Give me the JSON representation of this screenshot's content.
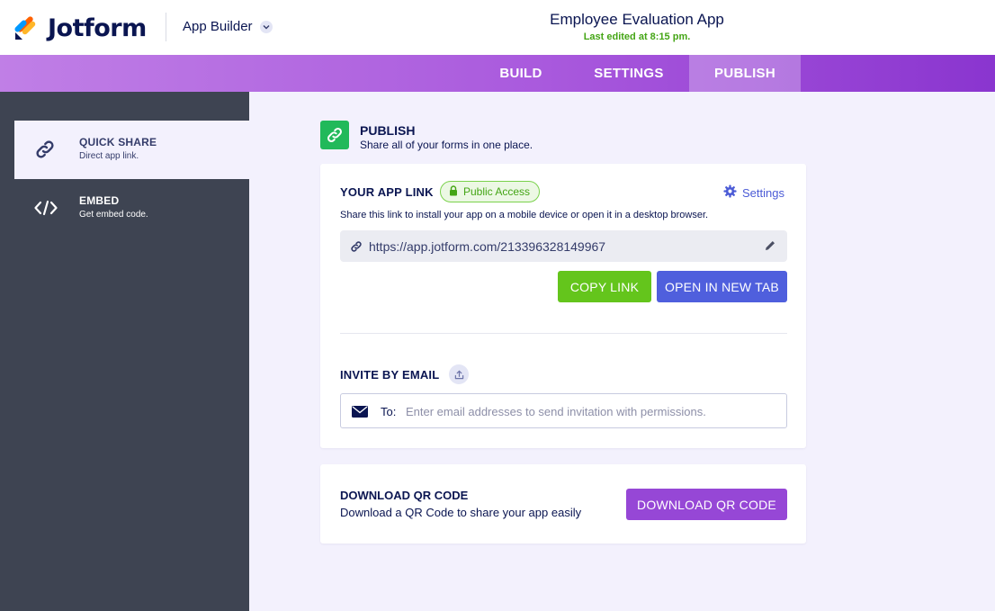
{
  "header": {
    "logo_text": "Jotform",
    "app_builder_label": "App Builder",
    "app_title": "Employee Evaluation App",
    "last_edited": "Last edited at 8:15 pm."
  },
  "nav": {
    "tabs": [
      {
        "label": "BUILD"
      },
      {
        "label": "SETTINGS"
      },
      {
        "label": "PUBLISH",
        "active": true
      }
    ]
  },
  "sidebar": {
    "items": [
      {
        "title": "QUICK SHARE",
        "subtitle": "Direct app link.",
        "icon": "link-icon",
        "active": true
      },
      {
        "title": "EMBED",
        "subtitle": "Get embed code.",
        "icon": "code-icon",
        "active": false
      }
    ]
  },
  "publish": {
    "title": "PUBLISH",
    "subtitle": "Share all of your forms in one place."
  },
  "app_link": {
    "label": "YOUR APP LINK",
    "badge": "Public Access",
    "settings_label": "Settings",
    "help_text": "Share this link to install your app on a mobile device or open it in a desktop browser.",
    "url": "https://app.jotform.com/213396328149967",
    "copy_label": "COPY LINK",
    "open_label": "OPEN IN NEW TAB"
  },
  "invite": {
    "label": "INVITE BY EMAIL",
    "to_label": "To:",
    "placeholder": "Enter email addresses to send invitation with permissions."
  },
  "qr": {
    "title": "DOWNLOAD QR CODE",
    "subtitle": "Download a QR Code to share your app easily",
    "button_label": "DOWNLOAD QR CODE"
  },
  "colors": {
    "green": "#64c51c",
    "blue": "#4f5fdd",
    "purple": "#9647d6",
    "sidebar": "#3e4452",
    "navy": "#0a1551"
  }
}
